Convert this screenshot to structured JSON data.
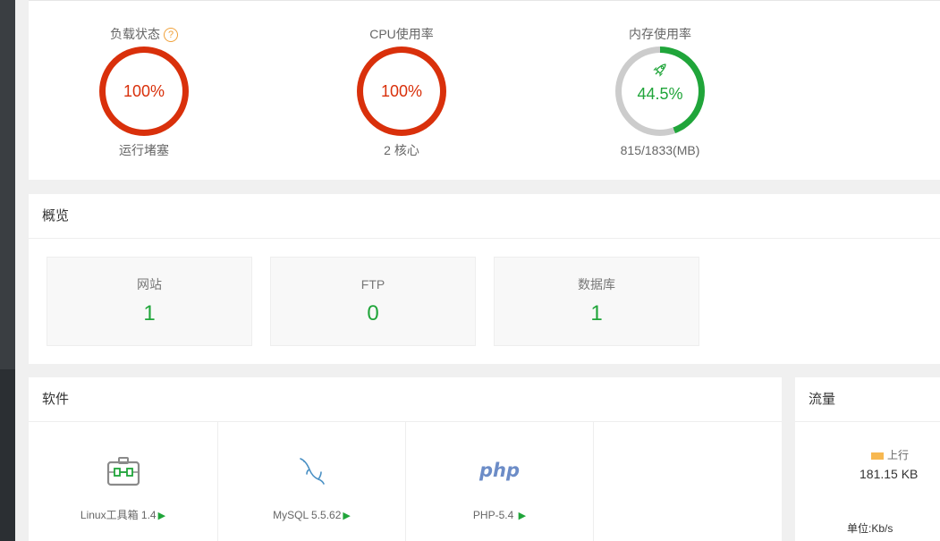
{
  "status": {
    "load": {
      "title": "负载状态",
      "help": "?",
      "value": "100%",
      "sub": "运行堵塞",
      "color": "#d9300b"
    },
    "cpu": {
      "title": "CPU使用率",
      "value": "100%",
      "sub": "2 核心",
      "color": "#d9300b"
    },
    "memory": {
      "title": "内存使用率",
      "value": "44.5%",
      "sub": "815/1833(MB)",
      "color": "#20a53a",
      "percent": 44.5
    }
  },
  "overview": {
    "title": "概览",
    "items": [
      {
        "label": "网站",
        "value": "1"
      },
      {
        "label": "FTP",
        "value": "0"
      },
      {
        "label": "数据库",
        "value": "1"
      }
    ]
  },
  "software": {
    "title": "软件",
    "items": [
      {
        "name": "Linux工具箱 1.4",
        "icon": "toolbox-icon"
      },
      {
        "name": "MySQL 5.5.62",
        "icon": "mysql-dolphin-icon"
      },
      {
        "name": "PHP-5.4",
        "icon": "php-icon"
      }
    ],
    "php_text": "php",
    "play": "▶"
  },
  "traffic": {
    "title": "流量",
    "up_label": "上行",
    "up_value": "181.15 KB",
    "unit": "单位:Kb/s",
    "up_color": "#f7b851"
  }
}
